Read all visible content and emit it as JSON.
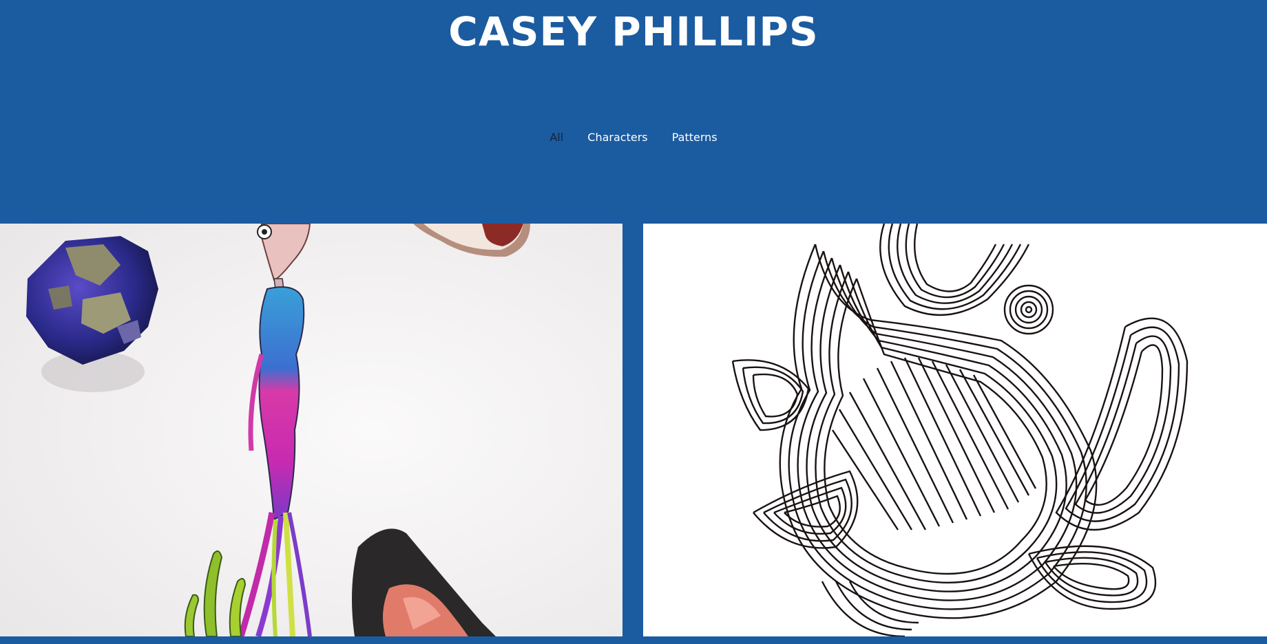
{
  "header": {
    "title": "CASEY PHILLIPS"
  },
  "filters": {
    "items": [
      {
        "label": "All",
        "active": true
      },
      {
        "label": "Characters",
        "active": false
      },
      {
        "label": "Patterns",
        "active": false
      }
    ]
  },
  "gallery": {
    "items": [
      {
        "category": "Characters",
        "icon": "character-drawing-artwork"
      },
      {
        "category": "Patterns",
        "icon": "line-pattern-artwork"
      }
    ]
  },
  "colors": {
    "background": "#1b5ba0",
    "title": "#ffffff",
    "active_filter": "#10253d"
  }
}
